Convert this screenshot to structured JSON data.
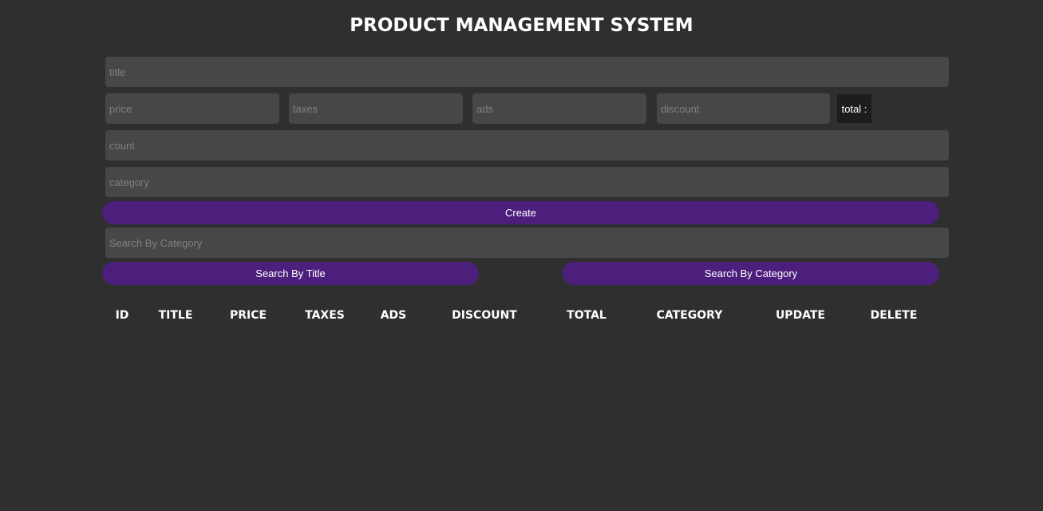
{
  "header": {
    "title": "PRODUCT MANAGEMENT SYSTEM"
  },
  "form": {
    "title_placeholder": "title",
    "price_placeholder": "price",
    "taxes_placeholder": "taxes",
    "ads_placeholder": "ads",
    "discount_placeholder": "discount",
    "total_label": "total :",
    "count_placeholder": "count",
    "category_placeholder": "category",
    "create_label": "Create"
  },
  "search": {
    "placeholder": "Search By Category",
    "by_title_label": "Search By Title",
    "by_category_label": "Search By Category"
  },
  "table": {
    "headers": [
      "ID",
      "TITLE",
      "PRICE",
      "TAXES",
      "ADS",
      "DISCOUNT",
      "TOTAL",
      "CATEGORY",
      "UPDATE",
      "DELETE"
    ],
    "rows": []
  },
  "colors": {
    "background": "#2f2f2f",
    "input": "#474749",
    "accent": "#4d1f7d",
    "total_box": "#1c1c1c"
  }
}
